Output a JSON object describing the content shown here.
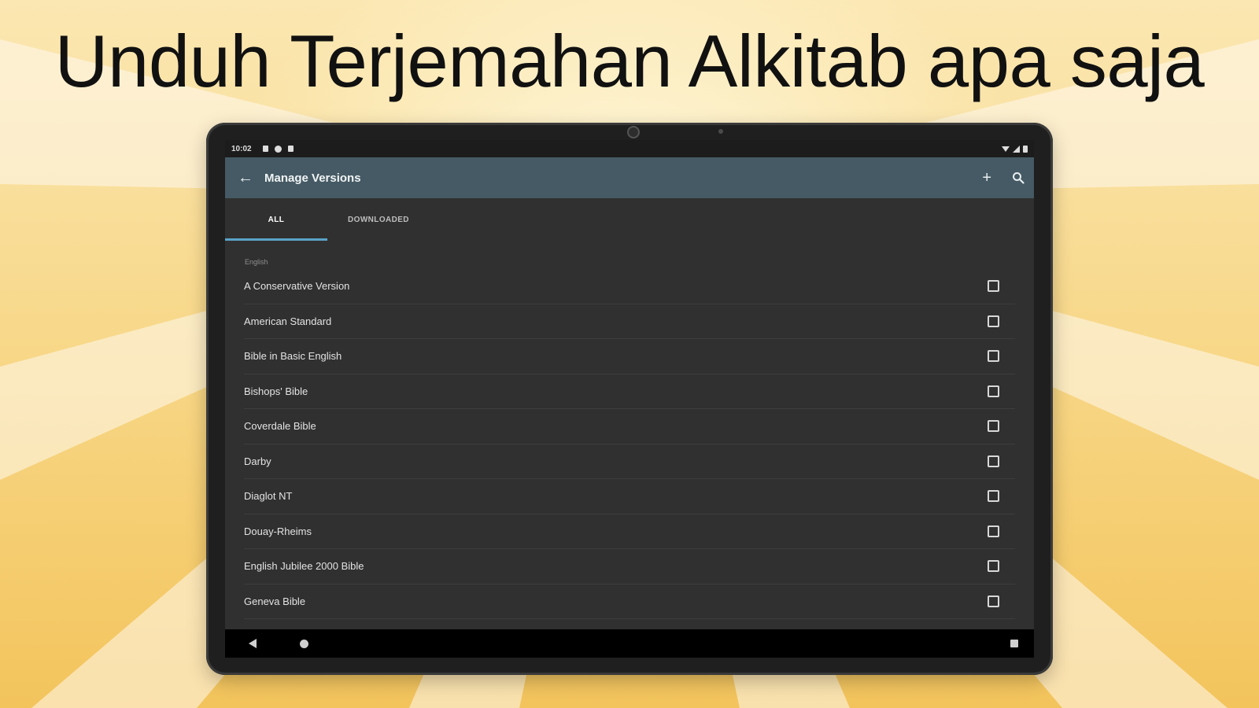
{
  "headline": "Unduh Terjemahan Alkitab apa saja",
  "status_bar": {
    "time": "10:02",
    "icons": [
      "notification-icon",
      "settings-icon",
      "lock-icon"
    ],
    "right_icons": [
      "wifi-icon",
      "signal-icon",
      "battery-icon"
    ]
  },
  "app_bar": {
    "back_icon": "arrow-left-icon",
    "title": "Manage Versions",
    "add_icon": "plus-icon",
    "search_icon": "search-icon"
  },
  "tabs": [
    {
      "label": "ALL",
      "active": true
    },
    {
      "label": "DOWNLOADED",
      "active": false
    }
  ],
  "section_header": "English",
  "versions": [
    {
      "name": "A Conservative Version",
      "checked": false
    },
    {
      "name": "American Standard",
      "checked": false
    },
    {
      "name": "Bible in Basic English",
      "checked": false
    },
    {
      "name": "Bishops' Bible",
      "checked": false
    },
    {
      "name": "Coverdale Bible",
      "checked": false
    },
    {
      "name": "Darby",
      "checked": false
    },
    {
      "name": "Diaglot NT",
      "checked": false
    },
    {
      "name": "Douay-Rheims",
      "checked": false
    },
    {
      "name": "English Jubilee 2000 Bible",
      "checked": false
    },
    {
      "name": "Geneva Bible",
      "checked": false
    }
  ],
  "colors": {
    "app_bar": "#455a64",
    "background": "#303030",
    "tab_indicator": "#5aa3c8"
  }
}
